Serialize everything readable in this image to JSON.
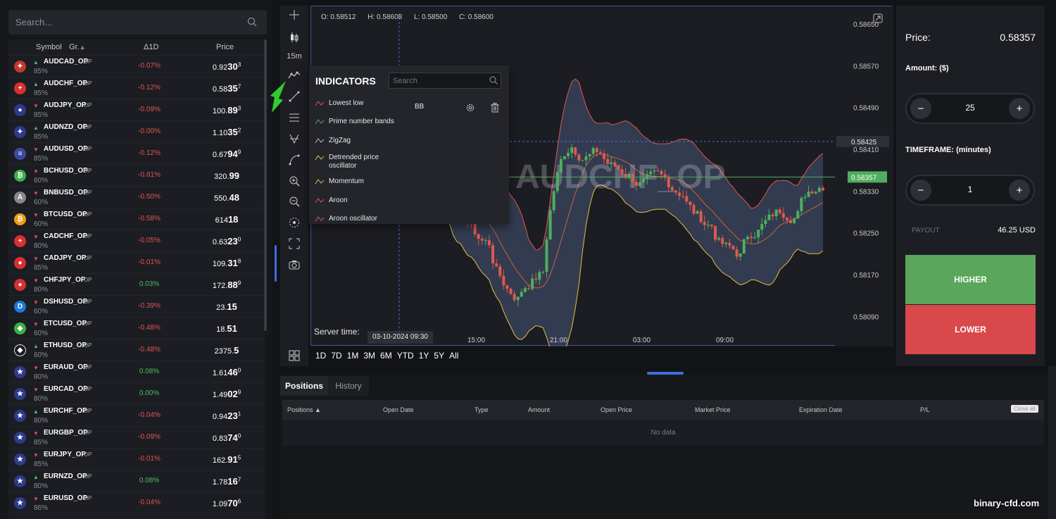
{
  "sidebar": {
    "search_placeholder": "Search...",
    "columns": {
      "symbol": "Symbol",
      "group": "Gr.",
      "change": "Δ1D",
      "price": "Price"
    },
    "rows": [
      {
        "symbol": "AUDCAD_OP",
        "tag": "OP",
        "payout": "85%",
        "dir": "up",
        "change": "-0.07%",
        "change_color": "#e05555",
        "price_a": "0.92",
        "price_b": "30",
        "price_c": "3",
        "flag": "#c0392b",
        "glyph": "✦"
      },
      {
        "symbol": "AUDCHF_OP",
        "tag": "OP",
        "payout": "85%",
        "dir": "up",
        "change": "-0.12%",
        "change_color": "#e05555",
        "price_a": "0.58",
        "price_b": "35",
        "price_c": "7",
        "flag": "#d63031",
        "glyph": "+"
      },
      {
        "symbol": "AUDJPY_OP",
        "tag": "OP",
        "payout": "85%",
        "dir": "down",
        "change": "-0.09%",
        "change_color": "#e05555",
        "price_a": "100.",
        "price_b": "89",
        "price_c": "3",
        "flag": "#2d3a8c",
        "glyph": "●"
      },
      {
        "symbol": "AUDNZD_OP",
        "tag": "OP",
        "payout": "85%",
        "dir": "up",
        "change": "-0.00%",
        "change_color": "#e05555",
        "price_a": "1.10",
        "price_b": "35",
        "price_c": "2",
        "flag": "#2d3a8c",
        "glyph": "✦"
      },
      {
        "symbol": "AUDUSD_OP",
        "tag": "OP",
        "payout": "85%",
        "dir": "down",
        "change": "-0.12%",
        "change_color": "#e05555",
        "price_a": "0.67",
        "price_b": "94",
        "price_c": "9",
        "flag": "#3b4aa0",
        "glyph": "≡"
      },
      {
        "symbol": "BCHUSD_OP",
        "tag": "OP",
        "payout": "60%",
        "dir": "down",
        "change": "-0.81%",
        "change_color": "#e05555",
        "price_a": "320.",
        "price_b": "99",
        "price_c": "",
        "flag": "#3fae49",
        "glyph": "₿"
      },
      {
        "symbol": "BNBUSD_OP",
        "tag": "OP",
        "payout": "60%",
        "dir": "down",
        "change": "-0.50%",
        "change_color": "#e05555",
        "price_a": "550.",
        "price_b": "48",
        "price_c": "",
        "flag": "#888888",
        "glyph": "A"
      },
      {
        "symbol": "BTCUSD_OP",
        "tag": "OP",
        "payout": "60%",
        "dir": "down",
        "change": "-0.58%",
        "change_color": "#e05555",
        "price_a": "614",
        "price_b": "18",
        "price_c": "",
        "flag": "#f39c12",
        "glyph": "₿"
      },
      {
        "symbol": "CADCHF_OP",
        "tag": "OP",
        "payout": "80%",
        "dir": "down",
        "change": "-0.05%",
        "change_color": "#e05555",
        "price_a": "0.63",
        "price_b": "23",
        "price_c": "0",
        "flag": "#d63031",
        "glyph": "+"
      },
      {
        "symbol": "CADJPY_OP",
        "tag": "OP",
        "payout": "85%",
        "dir": "down",
        "change": "-0.01%",
        "change_color": "#e05555",
        "price_a": "109.",
        "price_b": "31",
        "price_c": "8",
        "flag": "#d63031",
        "glyph": "●"
      },
      {
        "symbol": "CHFJPY_OP",
        "tag": "OP",
        "payout": "80%",
        "dir": "down",
        "change": "0.03%",
        "change_color": "#4fbf5e",
        "price_a": "172.",
        "price_b": "88",
        "price_c": "9",
        "flag": "#d63031",
        "glyph": "●"
      },
      {
        "symbol": "DSHUSD_OP",
        "tag": "OP",
        "payout": "60%",
        "dir": "down",
        "change": "-0.39%",
        "change_color": "#e05555",
        "price_a": "23.",
        "price_b": "15",
        "price_c": "",
        "flag": "#1e78d7",
        "glyph": "D"
      },
      {
        "symbol": "ETCUSD_OP",
        "tag": "OP",
        "payout": "60%",
        "dir": "down",
        "change": "-0.48%",
        "change_color": "#e05555",
        "price_a": "18.",
        "price_b": "51",
        "price_c": "",
        "flag": "#3fae49",
        "glyph": "◆"
      },
      {
        "symbol": "ETHUSD_OP",
        "tag": "OP",
        "payout": "60%",
        "dir": "up",
        "change": "-0.48%",
        "change_color": "#e05555",
        "price_a": "2375.",
        "price_b": "5",
        "price_c": "",
        "flag": "#1c1d22",
        "glyph": "◆"
      },
      {
        "symbol": "EURAUD_OP",
        "tag": "OP",
        "payout": "80%",
        "dir": "down",
        "change": "0.08%",
        "change_color": "#4fbf5e",
        "price_a": "1.61",
        "price_b": "46",
        "price_c": "0",
        "flag": "#2d3a8c",
        "glyph": "★"
      },
      {
        "symbol": "EURCAD_OP",
        "tag": "OP",
        "payout": "80%",
        "dir": "down",
        "change": "0.00%",
        "change_color": "#4fbf5e",
        "price_a": "1.49",
        "price_b": "02",
        "price_c": "9",
        "flag": "#2d3a8c",
        "glyph": "★"
      },
      {
        "symbol": "EURCHF_OP",
        "tag": "OP",
        "payout": "80%",
        "dir": "up",
        "change": "-0.04%",
        "change_color": "#e05555",
        "price_a": "0.94",
        "price_b": "23",
        "price_c": "1",
        "flag": "#2d3a8c",
        "glyph": "★"
      },
      {
        "symbol": "EURGBP_OP",
        "tag": "OP",
        "payout": "85%",
        "dir": "down",
        "change": "-0.09%",
        "change_color": "#e05555",
        "price_a": "0.83",
        "price_b": "74",
        "price_c": "0",
        "flag": "#2d3a8c",
        "glyph": "★"
      },
      {
        "symbol": "EURJPY_OP",
        "tag": "OP",
        "payout": "85%",
        "dir": "down",
        "change": "-0.01%",
        "change_color": "#e05555",
        "price_a": "162.",
        "price_b": "91",
        "price_c": "5",
        "flag": "#2d3a8c",
        "glyph": "★"
      },
      {
        "symbol": "EURNZD_OP",
        "tag": "OP",
        "payout": "80%",
        "dir": "up",
        "change": "0.08%",
        "change_color": "#4fbf5e",
        "price_a": "1.78",
        "price_b": "16",
        "price_c": "7",
        "flag": "#2d3a8c",
        "glyph": "★"
      },
      {
        "symbol": "EURUSD_OP",
        "tag": "OP",
        "payout": "86%",
        "dir": "down",
        "change": "-0.04%",
        "change_color": "#e05555",
        "price_a": "1.09",
        "price_b": "70",
        "price_c": "6",
        "flag": "#2d3a8c",
        "glyph": "★"
      }
    ]
  },
  "toolbar": {
    "timeframe_label": "15m"
  },
  "chart": {
    "ohlc": {
      "o": "O: 0.58512",
      "h": "H: 0.58608",
      "l": "L: 0.58500",
      "c": "C: 0.58600"
    },
    "watermark_symbol": "AUDCHF_OP",
    "y_ticks": [
      "0.58650",
      "0.58570",
      "0.58490",
      "0.58410",
      "0.58330",
      "0.58250",
      "0.58170",
      "0.58090"
    ],
    "price_marker": "0.58425",
    "current_price_marker": "0.58357",
    "x_ticks": [
      "15:00",
      "21:00",
      "03:00",
      "09:00"
    ],
    "server_time_label": "Server time:",
    "server_time_value": "03-10-2024 09:30",
    "ranges": [
      "1D",
      "7D",
      "1M",
      "3M",
      "6M",
      "YTD",
      "1Y",
      "5Y",
      "All"
    ],
    "up_color": "#4fae5d",
    "down_color": "#e0584c"
  },
  "indicators": {
    "title": "INDICATORS",
    "search_placeholder": "Search",
    "items": [
      "Lowest low",
      "Prime number bands",
      "ZigZag",
      "Detrended price oscillator",
      "Momentum",
      "Aroon",
      "Aroon oscillator"
    ],
    "active": "BB"
  },
  "trade": {
    "price_label": "Price:",
    "price_value": "0.58357",
    "amount_label": "Amount: ($)",
    "amount_value": "25",
    "timeframe_label": "TIMEFRAME: (minutes)",
    "timeframe_value": "1",
    "payout_label": "PAYOUT",
    "payout_value": "46.25 USD",
    "higher": "HIGHER",
    "lower": "LOWER",
    "higher_color": "#5aa65a",
    "lower_color": "#d9484b"
  },
  "positions": {
    "tabs": [
      "Positions",
      "History"
    ],
    "columns": [
      "Positions ▲",
      "Open Date",
      "Type",
      "Amount",
      "Open Price",
      "Market Price",
      "Expiration Date",
      "P/L"
    ],
    "close_all": "Close all",
    "empty": "No data"
  },
  "watermark": "binary-cfd.com"
}
